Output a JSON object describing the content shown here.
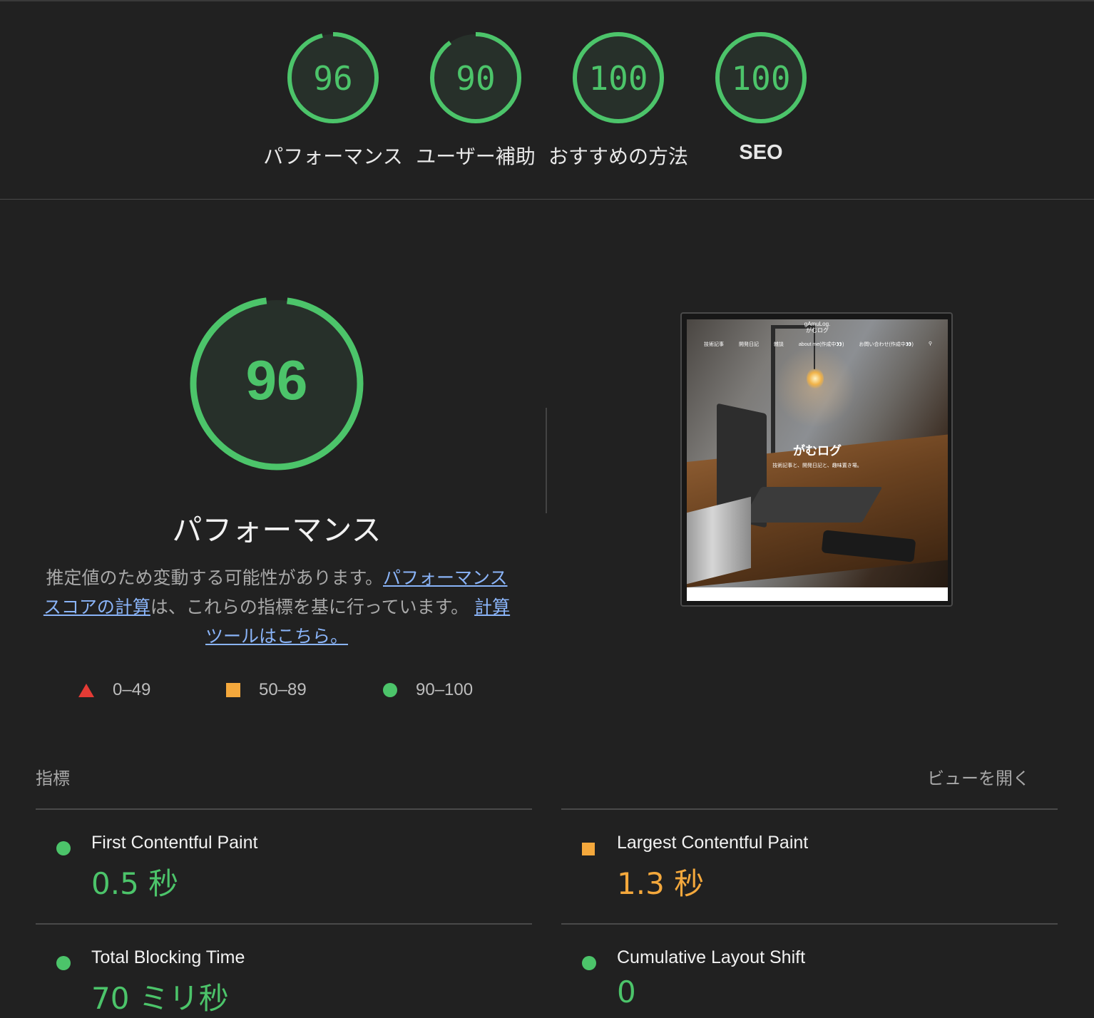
{
  "summary": {
    "gauges": [
      {
        "score": "96",
        "label": "パフォーマンス"
      },
      {
        "score": "90",
        "label": "ユーザー補助"
      },
      {
        "score": "100",
        "label": "おすすめの方法"
      },
      {
        "score": "100",
        "label": "SEO"
      }
    ]
  },
  "performance": {
    "score": "96",
    "score_value": 96,
    "title": "パフォーマンス",
    "description_text": "推定値のため変動する可能性があります。",
    "link_score_calc": "パフォーマンス スコアの計算",
    "description_mid": "は、これらの指標を基に行っています。",
    "link_calculator": "計算ツールはこちら。",
    "legend": [
      {
        "range": "0–49",
        "icon": "triangle-icon",
        "color": "#e53b35"
      },
      {
        "range": "50–89",
        "icon": "square-icon",
        "color": "#f4a83c"
      },
      {
        "range": "90–100",
        "icon": "circle-icon",
        "color": "#4cc46a"
      }
    ]
  },
  "screenshot": {
    "logo_line1": "gAmuLog.",
    "logo_line2": "がむログ",
    "nav": [
      "技術記事",
      "開発日記",
      "雑談",
      "about me(作成中👀)",
      "お問い合わせ(作成中👀)"
    ],
    "hero": "がむログ",
    "hero_sub": "技術記事と、開発日記と、趣味置き場。"
  },
  "metrics": {
    "heading": "指標",
    "toggle_label": "ビューを開く",
    "items": [
      {
        "title": "First Contentful Paint",
        "value": "0.5 秒",
        "status": "good",
        "icon": "circle-icon"
      },
      {
        "title": "Largest Contentful Paint",
        "value": "1.3 秒",
        "status": "average",
        "icon": "square-icon"
      },
      {
        "title": "Total Blocking Time",
        "value": "70 ミリ秒",
        "status": "good",
        "icon": "circle-icon"
      },
      {
        "title": "Cumulative Layout Shift",
        "value": "0",
        "status": "good",
        "icon": "circle-icon"
      }
    ]
  },
  "colors": {
    "background": "#212121",
    "good": "#4cc46a",
    "average": "#f4a83c",
    "fail": "#e53b35",
    "link": "#8ab4f8"
  }
}
